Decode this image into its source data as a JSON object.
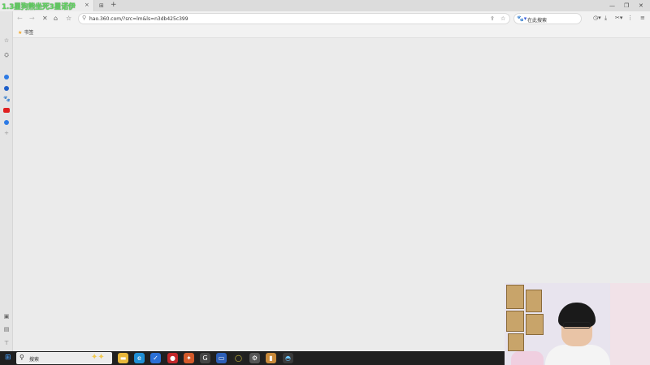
{
  "tab": {
    "title": "1.3星狗熊坐死3星诺伊",
    "close": "×",
    "new_tab": "+"
  },
  "address": {
    "url": "hao.360.com/?src=lm&ls=n3db425c399"
  },
  "search": {
    "placeholder": "在此搜索"
  },
  "bookmarks": {
    "folder_label": "书签"
  },
  "taskbar": {
    "search_label": "搜索"
  },
  "colors": {
    "tab_title": "#5fd35f",
    "accent": "#3b5bdb"
  }
}
